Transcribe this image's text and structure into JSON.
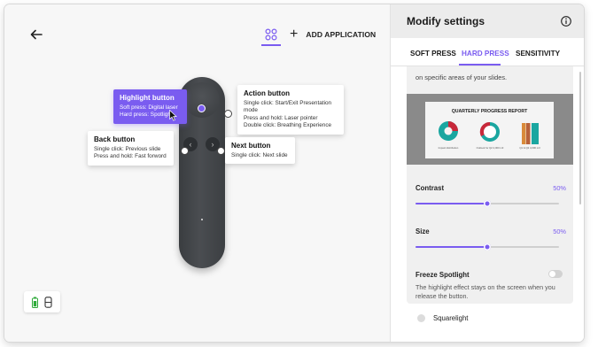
{
  "window": {
    "colors": {
      "accent": "#7a5cf0",
      "close": "#fe5f57",
      "minimize": "#febc2e",
      "zoom": "#28c840"
    }
  },
  "toolbar": {
    "back_icon": "arrow-left-icon",
    "apps_icon": "grid-circles-icon",
    "add_icon": "plus-icon",
    "add_label": "ADD APPLICATION"
  },
  "remote": {
    "callouts": {
      "highlight": {
        "title": "Highlight button",
        "lines": [
          "Soft press: Digital laser",
          "Hard press: Spotlight"
        ]
      },
      "action": {
        "title": "Action button",
        "lines": [
          "Single click: Start/Exit Presentation mode",
          "Press and hold: Laser pointer",
          "Double click: Breathing Experience"
        ]
      },
      "back": {
        "title": "Back button",
        "lines": [
          "Single click: Previous slide",
          "Press and hold: Fast forword"
        ]
      },
      "next": {
        "title": "Next button",
        "lines": [
          "Single click: Next slide"
        ]
      }
    },
    "prev_glyph": "‹",
    "next_glyph": "›"
  },
  "devices": {
    "icons": [
      "battery-icon",
      "receiver-icon"
    ]
  },
  "panel": {
    "title": "Modify settings",
    "info_icon": "info-icon",
    "tabs": [
      {
        "label": "SOFT PRESS",
        "active": false
      },
      {
        "label": "HARD PRESS",
        "active": true
      },
      {
        "label": "SENSITIVITY",
        "active": false
      }
    ],
    "description": "on specific areas of your slides.",
    "preview": {
      "slide_title": "QUARTERLY PROGRESS REPORT",
      "chart_captions": [
        "Impact distribution",
        "Outlook for Q2 2,000 m3",
        "Q1 & Q2 4,000 m3"
      ]
    },
    "contrast": {
      "label": "Contrast",
      "value_text": "50%",
      "value": 0.5
    },
    "size": {
      "label": "Size",
      "value_text": "50%",
      "value": 0.5
    },
    "freeze": {
      "label": "Freeze Spotlight",
      "enabled": false,
      "description": "The highlight effect stays on the screen when you release the button."
    },
    "option": {
      "label": "Squarelight",
      "selected": false
    }
  }
}
